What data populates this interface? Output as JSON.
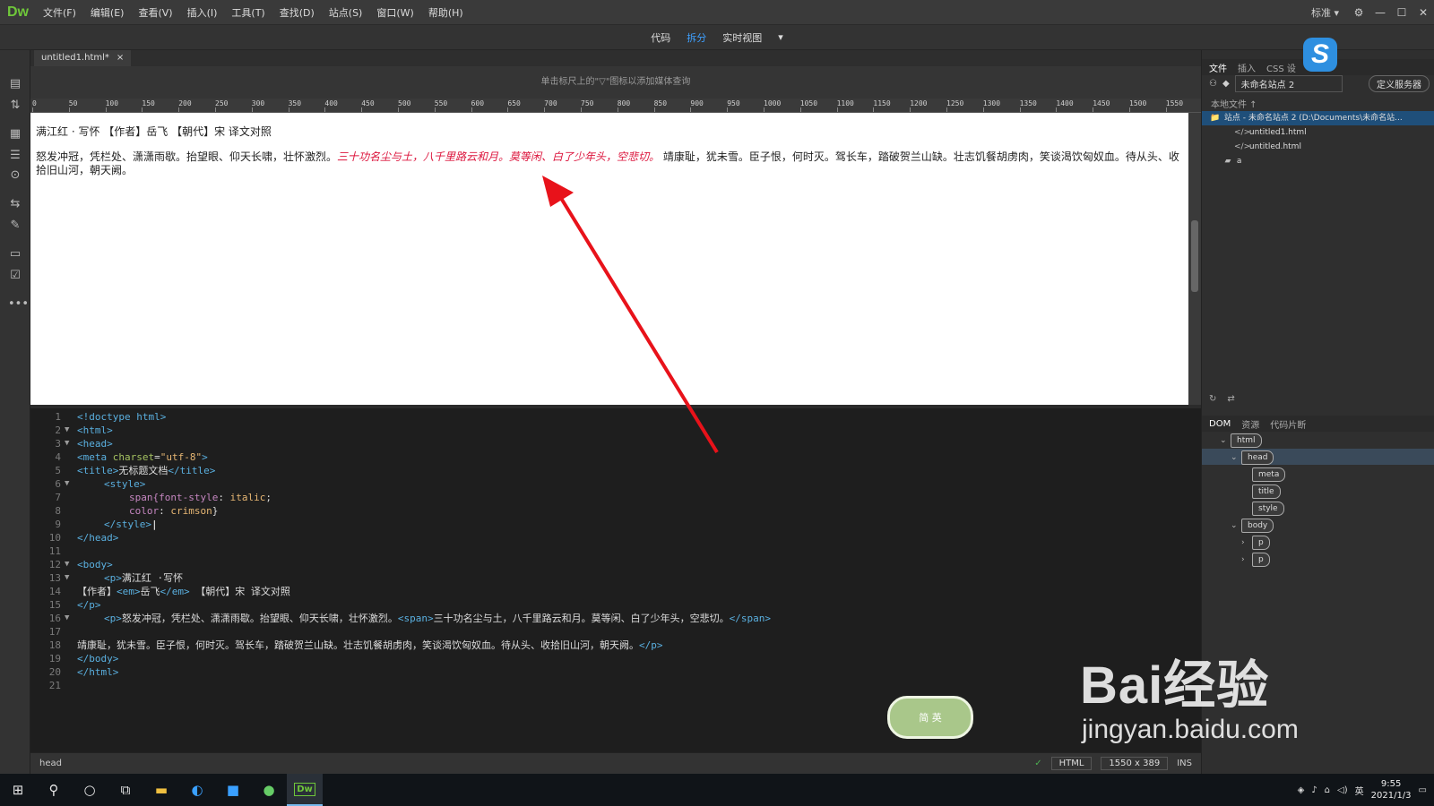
{
  "app": {
    "logo": "Dw",
    "menu": [
      "文件(F)",
      "编辑(E)",
      "查看(V)",
      "插入(I)",
      "工具(T)",
      "查找(D)",
      "站点(S)",
      "窗口(W)",
      "帮助(H)"
    ],
    "workspace": "标准 ▾",
    "window_controls": [
      "⚙",
      "—",
      "☐",
      "✕"
    ]
  },
  "viewbar": {
    "code": "代码",
    "split": "拆分",
    "live": "实时视图"
  },
  "document": {
    "tab_name": "untitled1.html*",
    "tab_close": "×",
    "media_hint": "单击标尺上的\"▽\"图标以添加媒体查询"
  },
  "ruler": {
    "labels": [
      "0",
      "50",
      "100",
      "150",
      "200",
      "250",
      "300",
      "350",
      "400",
      "450",
      "500",
      "550",
      "600",
      "650",
      "700",
      "750",
      "800",
      "850",
      "900",
      "950",
      "1000",
      "1050",
      "1100",
      "1150",
      "1200",
      "1250",
      "1300",
      "1350",
      "1400",
      "1450",
      "1500",
      "1550"
    ]
  },
  "live": {
    "title_line": "满江红 · 写怀 【作者】岳飞 【朝代】宋 译文对照",
    "body_before": "怒发冲冠，凭栏处、潇潇雨歇。抬望眼、仰天长啸，壮怀激烈。",
    "body_span": "三十功名尘与土，八千里路云和月。莫等闲、白了少年头，空悲切。",
    "body_after": " 靖康耻，犹未雪。臣子恨，何时灭。驾长车，踏破贺兰山缺。壮志饥餐胡虏肉，笑谈渴饮匈奴血。待从头、收拾旧山河，朝天阙。"
  },
  "code_lines": [
    {
      "n": "1",
      "fold": "",
      "html": "<span class='code'>&lt;!doctype html&gt;</span>"
    },
    {
      "n": "2",
      "fold": "▼",
      "html": ""
    },
    {
      "n": "3",
      "fold": "▼",
      "html": ""
    },
    {
      "n": "4",
      "fold": "",
      "html": ""
    },
    {
      "n": "5",
      "fold": "",
      "html": ""
    },
    {
      "n": "6",
      "fold": "▼",
      "html": ""
    },
    {
      "n": "7",
      "fold": "",
      "html": ""
    },
    {
      "n": "8",
      "fold": "",
      "html": ""
    },
    {
      "n": "9",
      "fold": "",
      "html": ""
    },
    {
      "n": "10",
      "fold": "",
      "html": ""
    },
    {
      "n": "11",
      "fold": "",
      "html": ""
    },
    {
      "n": "12",
      "fold": "▼",
      "html": ""
    },
    {
      "n": "13",
      "fold": "▼",
      "html": ""
    },
    {
      "n": "14",
      "fold": "",
      "html": ""
    },
    {
      "n": "15",
      "fold": "",
      "html": ""
    },
    {
      "n": "16",
      "fold": "▼",
      "html": ""
    },
    {
      "n": "17",
      "fold": "",
      "html": ""
    },
    {
      "n": "18",
      "fold": "",
      "html": ""
    },
    {
      "n": "19",
      "fold": "",
      "html": ""
    },
    {
      "n": "20",
      "fold": "",
      "html": ""
    },
    {
      "n": "21",
      "fold": "",
      "html": ""
    }
  ],
  "code_text": {
    "l1": "<!doctype html>",
    "l2": "<html>",
    "l3": "<head>",
    "l4_tag_open": "<meta ",
    "l4_attr": "charset",
    "l4_eq": "=",
    "l4_val": "\"utf-8\"",
    "l4_close": ">",
    "l5_open": "<title>",
    "l5_text": "无标题文档",
    "l5_close": "</title>",
    "l6": "<style>",
    "l7_sel": "span{",
    "l7_prop": "font-style",
    "l7_colon": ": ",
    "l7_val": "italic",
    "l7_end": ";",
    "l8_prop": "color",
    "l8_colon": ": ",
    "l8_val": "crimson",
    "l8_end": "}",
    "l9": "</style>",
    "l10": "</head>",
    "l12": "<body>",
    "l13_open": "<p>",
    "l13_text": "满江红 ·写怀",
    "l14_pre": "【作者】",
    "l14_em_open": "<em>",
    "l14_em_text": "岳飞",
    "l14_em_close": "</em>",
    "l14_post": " 【朝代】宋 译文对照",
    "l15": "</p>",
    "l16_open": "<p>",
    "l16_text": "怒发冲冠，凭栏处、潇潇雨歇。抬望眼、仰天长啸，壮怀激烈。",
    "l16_span_open": "<span>",
    "l16_span_text": "三十功名尘与土，八千里路云和月。莫等闲、白了少年头，空悲切。",
    "l16_span_close": "</span>",
    "l18_text": "靖康耻，犹未雪。臣子恨，何时灭。驾长车，踏破贺兰山缺。壮志饥餐胡虏肉，笑谈渴饮匈奴血。待从头、收拾旧山河，朝天阙。",
    "l18_close": "</p>",
    "l19": "</body>",
    "l20": "</html>"
  },
  "status": {
    "tag": "head",
    "doc_type": "HTML",
    "size": "1550 x 389",
    "ins": "INS"
  },
  "files_panel": {
    "tabs": [
      "文件",
      "插入",
      "CSS 设"
    ],
    "site": "未命名站点 2",
    "define_server": "定义服务器",
    "local_files": "本地文件 ↑",
    "rows": [
      {
        "label": "站点 - 未命名站点 2 (D:\\Documents\\未命名站...",
        "icon": "📁",
        "depth": 0,
        "selected": true
      },
      {
        "label": "untitled1.html",
        "icon": "</>",
        "depth": 2,
        "selected": false
      },
      {
        "label": "untitled.html",
        "icon": "</>",
        "depth": 2,
        "selected": false
      },
      {
        "label": "a",
        "icon": "▰",
        "depth": 1,
        "selected": false
      }
    ]
  },
  "dom_panel": {
    "tabs": [
      "DOM",
      "资源",
      "代码片断"
    ],
    "nodes": [
      {
        "label": "html",
        "depth": 0,
        "chev": "⌄",
        "hl": false
      },
      {
        "label": "head",
        "depth": 1,
        "chev": "⌄",
        "hl": true
      },
      {
        "label": "meta",
        "depth": 2,
        "chev": "",
        "hl": false
      },
      {
        "label": "title",
        "depth": 2,
        "chev": "",
        "hl": false
      },
      {
        "label": "style",
        "depth": 2,
        "chev": "",
        "hl": false
      },
      {
        "label": "body",
        "depth": 1,
        "chev": "⌄",
        "hl": false
      },
      {
        "label": "p",
        "depth": 2,
        "chev": "›",
        "hl": false
      },
      {
        "label": "p",
        "depth": 2,
        "chev": "›",
        "hl": false
      }
    ]
  },
  "taskbar": {
    "clock_time": "9:55",
    "clock_date": "2021/1/3",
    "ime": "英"
  },
  "watermark": {
    "brand": "Bai经验",
    "url": "jingyan.baidu.com"
  },
  "badge": {
    "line1": "简",
    "line2": "英"
  },
  "s_logo": "S"
}
